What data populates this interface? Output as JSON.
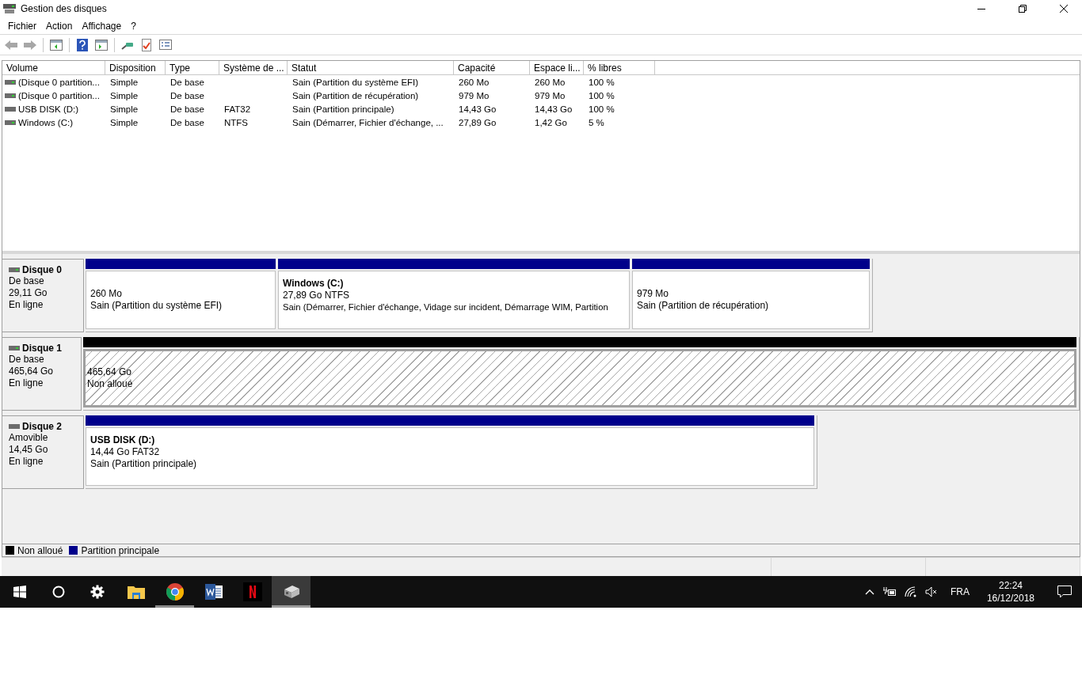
{
  "window": {
    "title": "Gestion des disques"
  },
  "menu": [
    "Fichier",
    "Action",
    "Affichage",
    "?"
  ],
  "toolbar": [
    {
      "kind": "back",
      "disabled": true
    },
    {
      "kind": "forward",
      "disabled": true
    },
    {
      "kind": "sep"
    },
    {
      "kind": "tree",
      "disabled": false
    },
    {
      "kind": "sep"
    },
    {
      "kind": "help",
      "disabled": false
    },
    {
      "kind": "pane",
      "disabled": false
    },
    {
      "kind": "sep"
    },
    {
      "kind": "connect",
      "disabled": false
    },
    {
      "kind": "properties",
      "disabled": false
    },
    {
      "kind": "list",
      "disabled": false
    }
  ],
  "table": {
    "columns": [
      "Volume",
      "Disposition",
      "Type",
      "Système de ...",
      "Statut",
      "Capacité",
      "Espace li...",
      "% libres"
    ],
    "rows": [
      {
        "removable": false,
        "cells": [
          "(Disque 0 partition...",
          "Simple",
          "De base",
          "",
          "Sain (Partition du système EFI)",
          "260 Mo",
          "260 Mo",
          "100 %"
        ]
      },
      {
        "removable": false,
        "cells": [
          "(Disque 0 partition...",
          "Simple",
          "De base",
          "",
          "Sain (Partition de récupération)",
          "979 Mo",
          "979 Mo",
          "100 %"
        ]
      },
      {
        "removable": true,
        "cells": [
          "USB DISK (D:)",
          "Simple",
          "De base",
          "FAT32",
          "Sain (Partition principale)",
          "14,43 Go",
          "14,43 Go",
          "100 %"
        ]
      },
      {
        "removable": false,
        "cells": [
          "Windows (C:)",
          "Simple",
          "De base",
          "NTFS",
          "Sain (Démarrer, Fichier d'échange, ...",
          "27,89 Go",
          "1,42 Go",
          "5 %"
        ]
      }
    ]
  },
  "disks": [
    {
      "name": "Disque 0",
      "removable": false,
      "type": "De base",
      "size": "29,11 Go",
      "status": "En ligne",
      "partitions": [
        {
          "kind": "primary",
          "size": "260 Mo",
          "status": "Sain (Partition du système EFI)"
        },
        {
          "kind": "primary",
          "title": "Windows  (C:)",
          "size": "27,89 Go NTFS",
          "status": "Sain (Démarrer, Fichier d'échange, Vidage sur incident, Démarrage WIM, Partition"
        },
        {
          "kind": "primary",
          "size": "979 Mo",
          "status": "Sain (Partition de récupération)"
        }
      ]
    },
    {
      "name": "Disque 1",
      "removable": false,
      "type": "De base",
      "size": "465,64 Go",
      "status": "En ligne",
      "selected": true,
      "partitions": [
        {
          "kind": "unallocated",
          "size": "465,64 Go",
          "status": "Non alloué"
        }
      ]
    },
    {
      "name": "Disque 2",
      "removable": true,
      "type": "Amovible",
      "size": "14,45 Go",
      "status": "En ligne",
      "partitions": [
        {
          "kind": "primary",
          "title": "USB DISK  (D:)",
          "size": "14,44 Go FAT32",
          "status": "Sain (Partition principale)"
        }
      ]
    }
  ],
  "legend": [
    {
      "label": "Non alloué",
      "color": "#000000"
    },
    {
      "label": "Partition principale",
      "color": "#00008b"
    }
  ],
  "taskbar": {
    "apps": [
      {
        "kind": "start",
        "running": false,
        "selected": false
      },
      {
        "kind": "search",
        "running": false,
        "selected": false
      },
      {
        "kind": "settings",
        "running": false,
        "selected": false
      },
      {
        "kind": "explorer",
        "running": false,
        "selected": false
      },
      {
        "kind": "chrome",
        "running": true,
        "selected": false
      },
      {
        "kind": "word",
        "running": false,
        "selected": false
      },
      {
        "kind": "netflix",
        "running": false,
        "selected": false
      },
      {
        "kind": "diskmgmt",
        "running": true,
        "selected": true
      }
    ],
    "language": "FRA",
    "time": "22:24",
    "date": "16/12/2018"
  }
}
